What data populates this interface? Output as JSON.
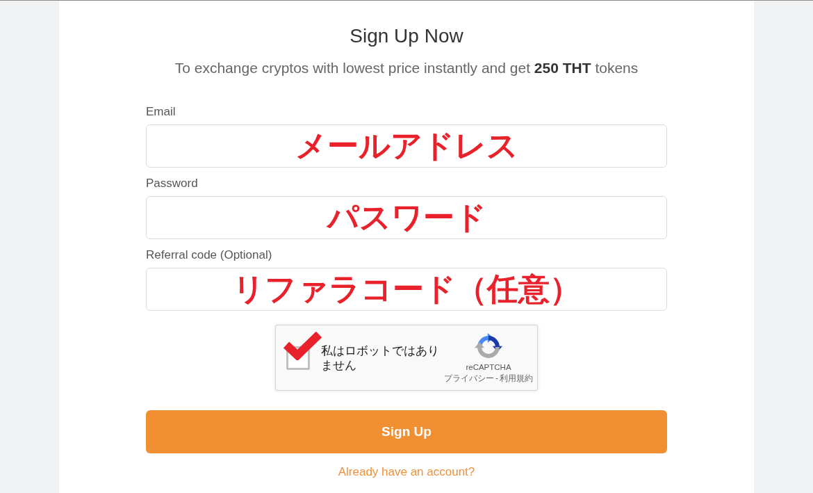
{
  "title": "Sign Up Now",
  "subtitle": "To exchange cryptos with lowest price instantly and get **250 THT** tokens",
  "fields": [
    {
      "label": "Email",
      "annotation": "メールアドレス"
    },
    {
      "label": "Password",
      "annotation": "パスワード"
    },
    {
      "label": "Referral code (Optional)",
      "annotation": "リファラコード（任意）"
    }
  ],
  "captcha": {
    "checked": true,
    "label": "私はロボットではありません",
    "brand": "reCAPTCHA",
    "links": [
      "プライバシー",
      "利用規約"
    ],
    "link_separator": "-"
  },
  "submit_button": {
    "label": "Sign Up"
  },
  "login_link": "Already have an account?"
}
